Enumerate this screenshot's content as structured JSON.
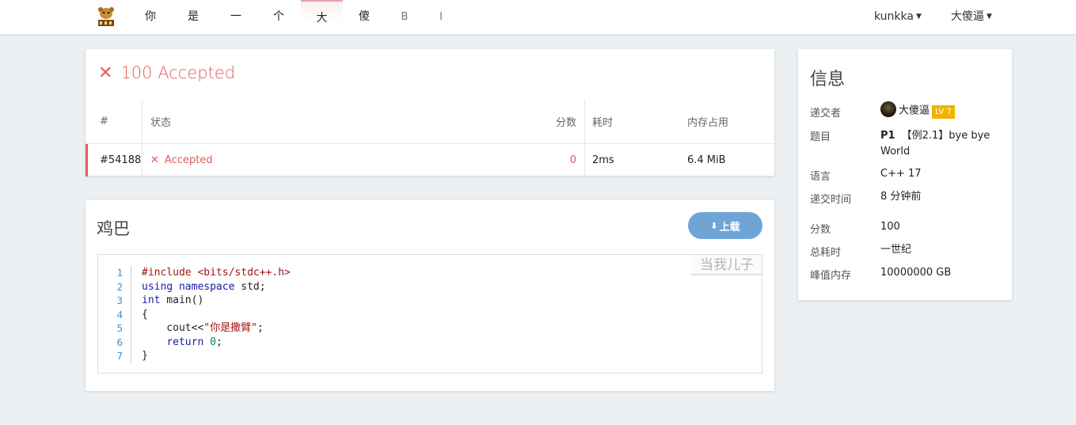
{
  "nav": {
    "items": [
      "你",
      "是",
      "一",
      "个",
      "大",
      "傻",
      "B",
      "I"
    ],
    "user_menu": "kunkka",
    "alt_menu": "大傻逼"
  },
  "submission": {
    "title": "100 Accepted",
    "headers": {
      "id": "#",
      "status": "状态",
      "score": "分数",
      "time": "耗时",
      "memory": "内存占用"
    },
    "row": {
      "id": "#54188",
      "status": "Accepted",
      "score": "0",
      "time": "2ms",
      "memory": "6.4 MiB"
    }
  },
  "code": {
    "title": "鸡巴",
    "download_label": "上载",
    "watermark": "当我儿子",
    "line_numbers": [
      "1",
      "2",
      "3",
      "4",
      "5",
      "6",
      "7"
    ]
  },
  "info": {
    "title": "信息",
    "submitter_label": "递交者",
    "submitter": "大傻逼",
    "level": "LV 7",
    "problem_label": "题目",
    "problem_id": "P1",
    "problem_name": "【例2.1】bye bye World",
    "language_label": "语言",
    "language": "C++ 17",
    "submit_time_label": "递交时间",
    "submit_time": "8 分钟前",
    "score_label": "分数",
    "score": "100",
    "total_time_label": "总耗时",
    "total_time": "一世纪",
    "peak_mem_label": "峰值内存",
    "peak_mem": "10000000 GB"
  },
  "colors": {
    "error": "#e05c5c",
    "accent": "#6fa4d6",
    "level": "#f0b400"
  }
}
